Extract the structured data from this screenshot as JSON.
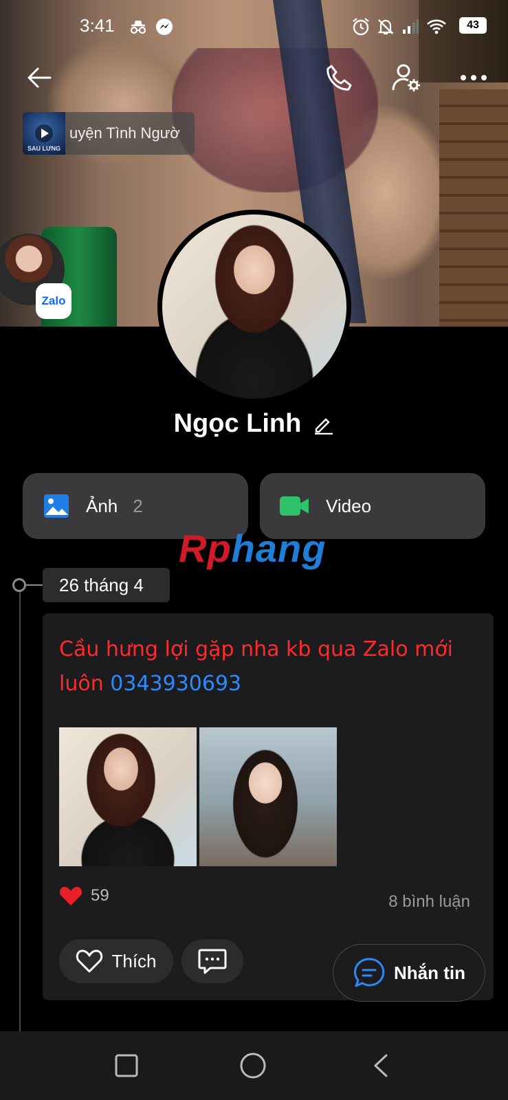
{
  "status_bar": {
    "time": "3:41",
    "icons": [
      "incognito-icon",
      "messenger-icon",
      "alarm-icon",
      "mute-icon",
      "signal-icon",
      "wifi-icon"
    ],
    "battery": "43"
  },
  "header": {
    "back_icon": "arrow-left-icon",
    "call_icon": "phone-icon",
    "settings_icon": "user-settings-icon",
    "more_icon": "more-dots-icon"
  },
  "music": {
    "thumb_caption": "SAU LƯNG",
    "title": "uyện Tình Ngườ"
  },
  "zalo_badge": "Zalo",
  "profile": {
    "name": "Ngọc Linh"
  },
  "tiles": {
    "photos": {
      "label": "Ảnh",
      "count": "2"
    },
    "video": {
      "label": "Video"
    }
  },
  "watermark": "Rphang",
  "timeline": {
    "date": "26 tháng 4"
  },
  "post": {
    "text": "Cầu hưng lợi gặp nha kb qua Zalo mới luôn ",
    "phone": "0343930693",
    "likes": "59",
    "comments": "8 bình luận",
    "like_label": "Thích"
  },
  "message_button": "Nhắn tin",
  "colors": {
    "post_text": "#ff2b2b",
    "phone": "#2a8bff",
    "photo_icon": "#1f7fe6",
    "video_icon": "#2ec26a",
    "card_bg": "#1c1c1e"
  }
}
